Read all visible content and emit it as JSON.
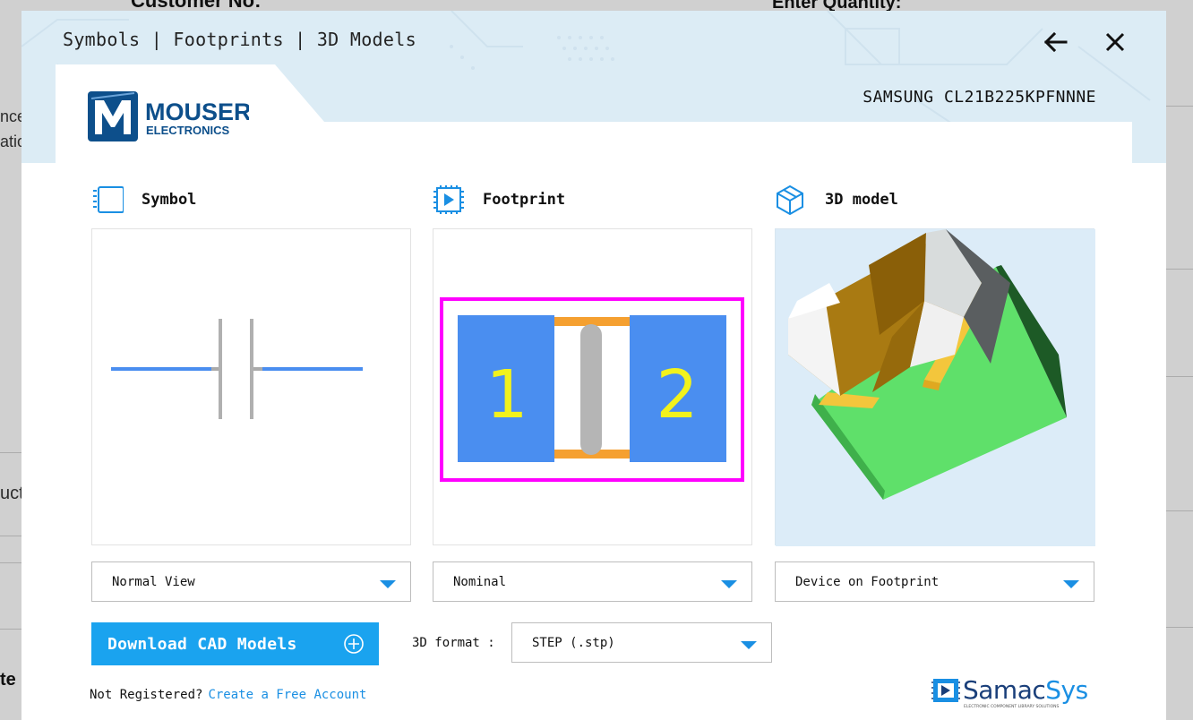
{
  "background_page": {
    "customer_no_label": "Customer No:",
    "enter_quantity_label": "Enter Quantity:",
    "fragment_1": "nce",
    "fragment_2": "atio",
    "fragment_3": "uct",
    "fragment_4": "te"
  },
  "modal": {
    "title": "Symbols | Footprints | 3D Models",
    "back_icon": "arrow-left-icon",
    "close_icon": "close-icon"
  },
  "brand": {
    "logo_line1": "MOUSER",
    "logo_line2": "ELECTRONICS",
    "logo_color": "#0d4f8b"
  },
  "part_number": "SAMSUNG CL21B225KPFNNNE",
  "sections": {
    "symbol": {
      "label": "Symbol",
      "icon": "symbol-icon"
    },
    "footprint": {
      "label": "Footprint",
      "icon": "footprint-icon",
      "pad_labels": [
        "1",
        "2"
      ]
    },
    "model3d": {
      "label": "3D model",
      "icon": "cube-icon"
    }
  },
  "selects": {
    "symbol_view": "Normal View",
    "footprint_view": "Nominal",
    "model_view": "Device on Footprint",
    "format_label": "3D format :",
    "format_value": "STEP (.stp)"
  },
  "download": {
    "label": "Download CAD Models",
    "icon": "plus-circle-icon"
  },
  "footer": {
    "not_registered": "Not Registered?",
    "create_account": "Create a Free Account"
  },
  "samacsys": {
    "name_part1": "Samac",
    "name_part2": "Sys",
    "tagline": "ELECTRONIC COMPONENT LIBRARY SOLUTIONS"
  },
  "colors": {
    "accent": "#1aa3ef",
    "header_bg": "#dcecf5",
    "footprint_outline": "#ff00ff",
    "footprint_pad": "#4a8ef0",
    "footprint_label": "#f2f21c",
    "model_board": "#5fe06a",
    "model_body": "#9a7210"
  }
}
